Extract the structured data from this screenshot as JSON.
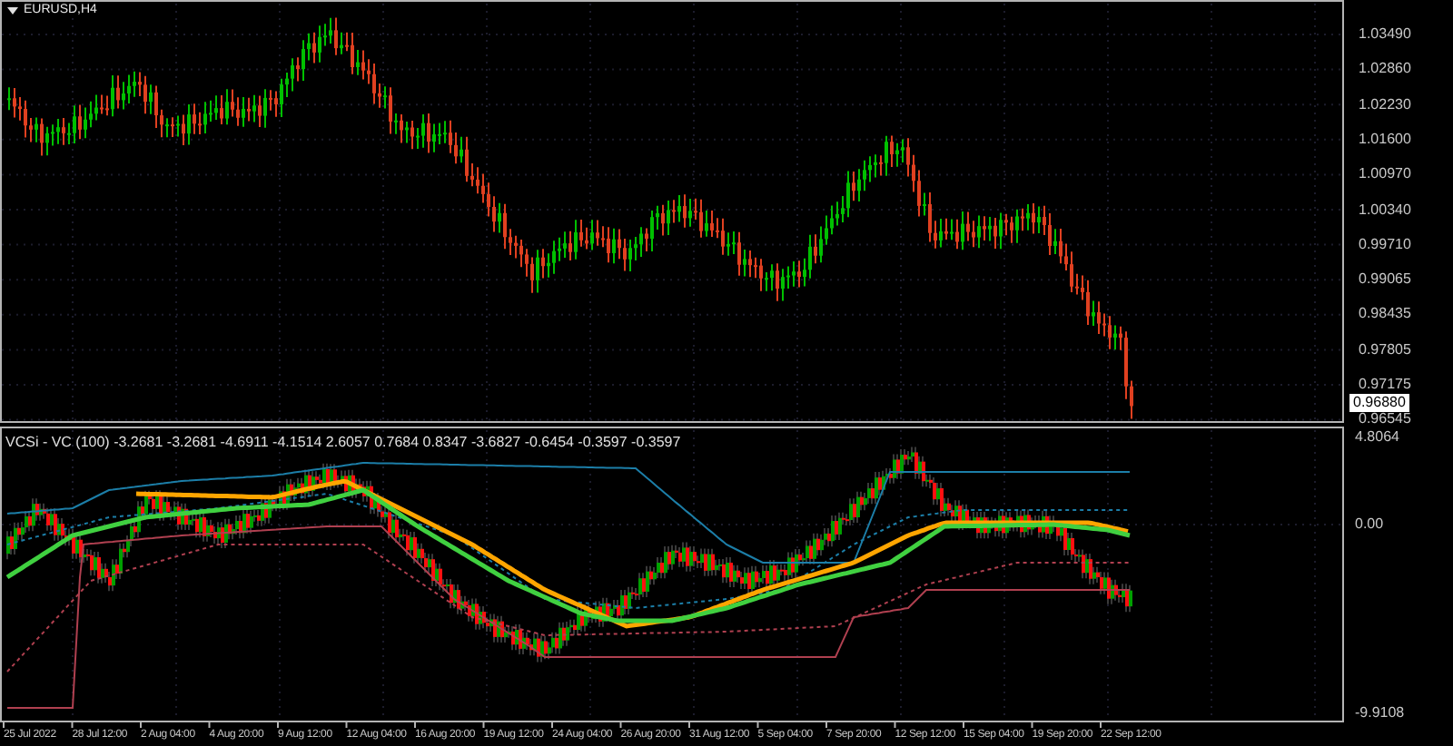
{
  "main_chart": {
    "title": "EURUSD,H4",
    "price_axis": [
      "1.03490",
      "1.02860",
      "1.02230",
      "1.01600",
      "1.00970",
      "1.00340",
      "0.99710",
      "0.99065",
      "0.98435",
      "0.97805",
      "0.97175",
      "0.96545"
    ],
    "current_price": "0.96880"
  },
  "indicator": {
    "title": "VCSi - VC (100) -3.2681 -3.2681 -4.6911 -4.1514 2.6057 0.7684 0.8347 -3.6827 -0.6454 -0.3597 -0.3597",
    "axis": [
      "4.8064",
      "0.00",
      "-9.9108"
    ]
  },
  "time_axis": [
    "25 Jul 2022",
    "28 Jul 12:00",
    "2 Aug 04:00",
    "4 Aug 20:00",
    "9 Aug 12:00",
    "12 Aug 04:00",
    "16 Aug 20:00",
    "19 Aug 12:00",
    "24 Aug 04:00",
    "26 Aug 20:00",
    "31 Aug 12:00",
    "5 Sep 04:00",
    "7 Sep 20:00",
    "12 Sep 12:00",
    "15 Sep 04:00",
    "19 Sep 20:00",
    "22 Sep 12:00"
  ]
}
